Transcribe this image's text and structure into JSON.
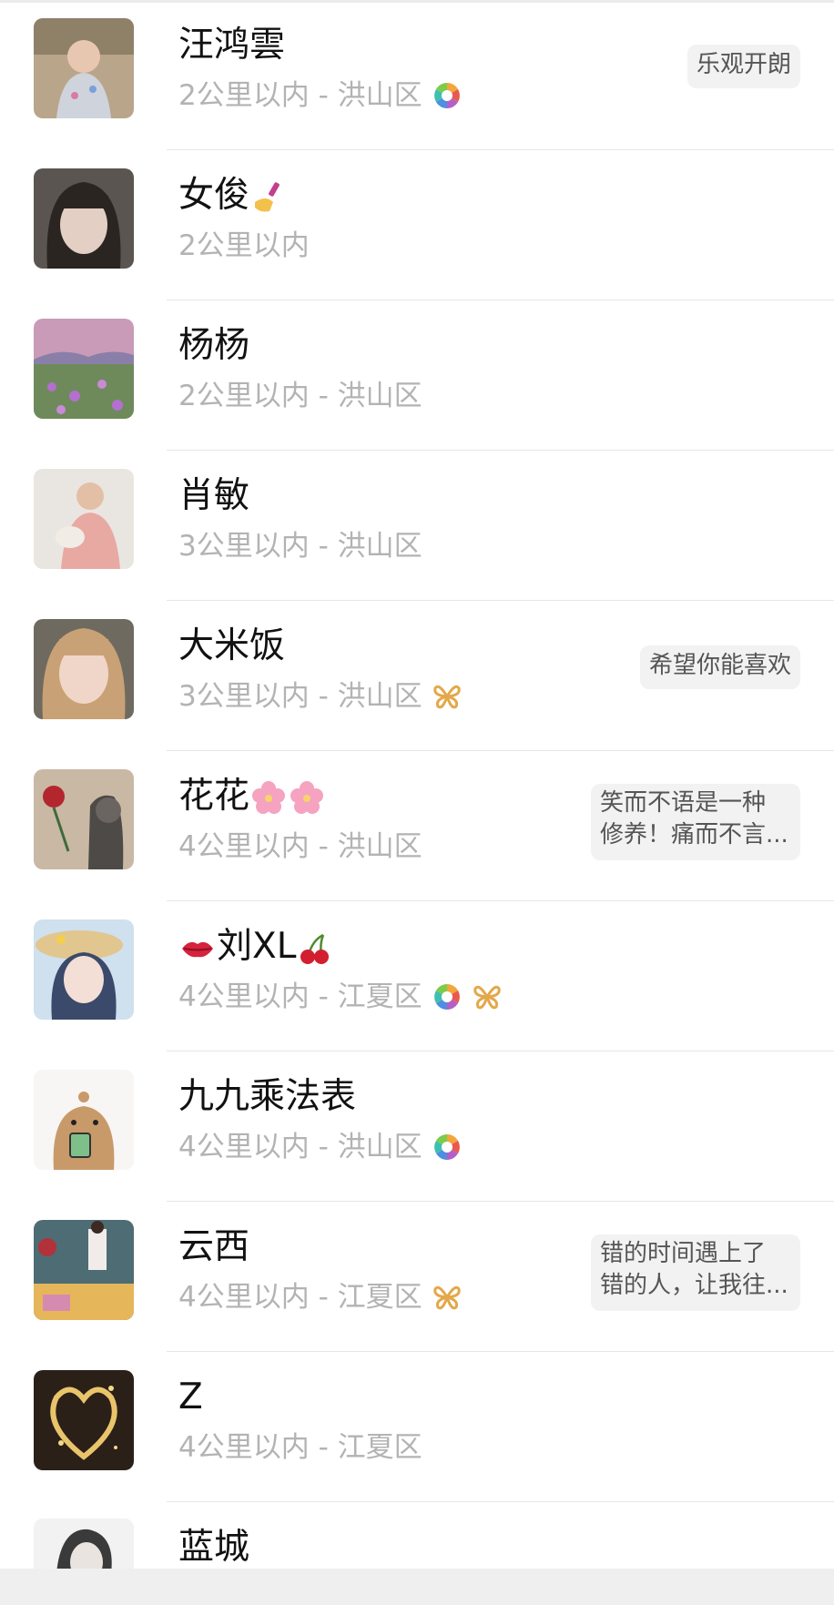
{
  "contacts": [
    {
      "name": "汪鸿雲",
      "distance": "2公里以内 - 洪山区",
      "icons": [
        "rainbow-shutter-icon"
      ],
      "tag": "乐观开朗"
    },
    {
      "name": "女俊",
      "name_emoji": "nail-polish-icon",
      "distance": "2公里以内",
      "icons": [],
      "tag": ""
    },
    {
      "name": "杨杨",
      "distance": "2公里以内 - 洪山区",
      "icons": [],
      "tag": ""
    },
    {
      "name": "肖敏",
      "distance": "3公里以内 - 洪山区",
      "icons": [],
      "tag": ""
    },
    {
      "name": "大米饭",
      "distance": "3公里以内 - 洪山区",
      "icons": [
        "butterfly-icon"
      ],
      "tag": "希望你能喜欢"
    },
    {
      "name": "花花",
      "name_emoji": "cherry-blossom-icon",
      "distance": "4公里以内 - 洪山区",
      "icons": [],
      "tag_line1": "笑而不语是一种",
      "tag_line2": "修养！痛而不言..."
    },
    {
      "name": "刘XL",
      "distance": "4公里以内 - 江夏区",
      "icons": [
        "rainbow-shutter-icon",
        "butterfly-icon"
      ],
      "tag": ""
    },
    {
      "name": "九九乘法表",
      "distance": "4公里以内 - 洪山区",
      "icons": [
        "rainbow-shutter-icon"
      ],
      "tag": ""
    },
    {
      "name": "云西",
      "distance": "4公里以内 - 江夏区",
      "icons": [
        "butterfly-icon"
      ],
      "tag_line1": "错的时间遇上了",
      "tag_line2": "错的人，让我往..."
    },
    {
      "name": "Z",
      "distance": "4公里以内 - 江夏区",
      "icons": [],
      "tag": ""
    },
    {
      "name": "蓝城",
      "distance": "",
      "icons": [],
      "tag": ""
    }
  ],
  "colors": {
    "name": "#111111",
    "meta": "#b3b3b3",
    "tag_bg": "#f2f2f2",
    "butterfly": "#e3a84a"
  }
}
